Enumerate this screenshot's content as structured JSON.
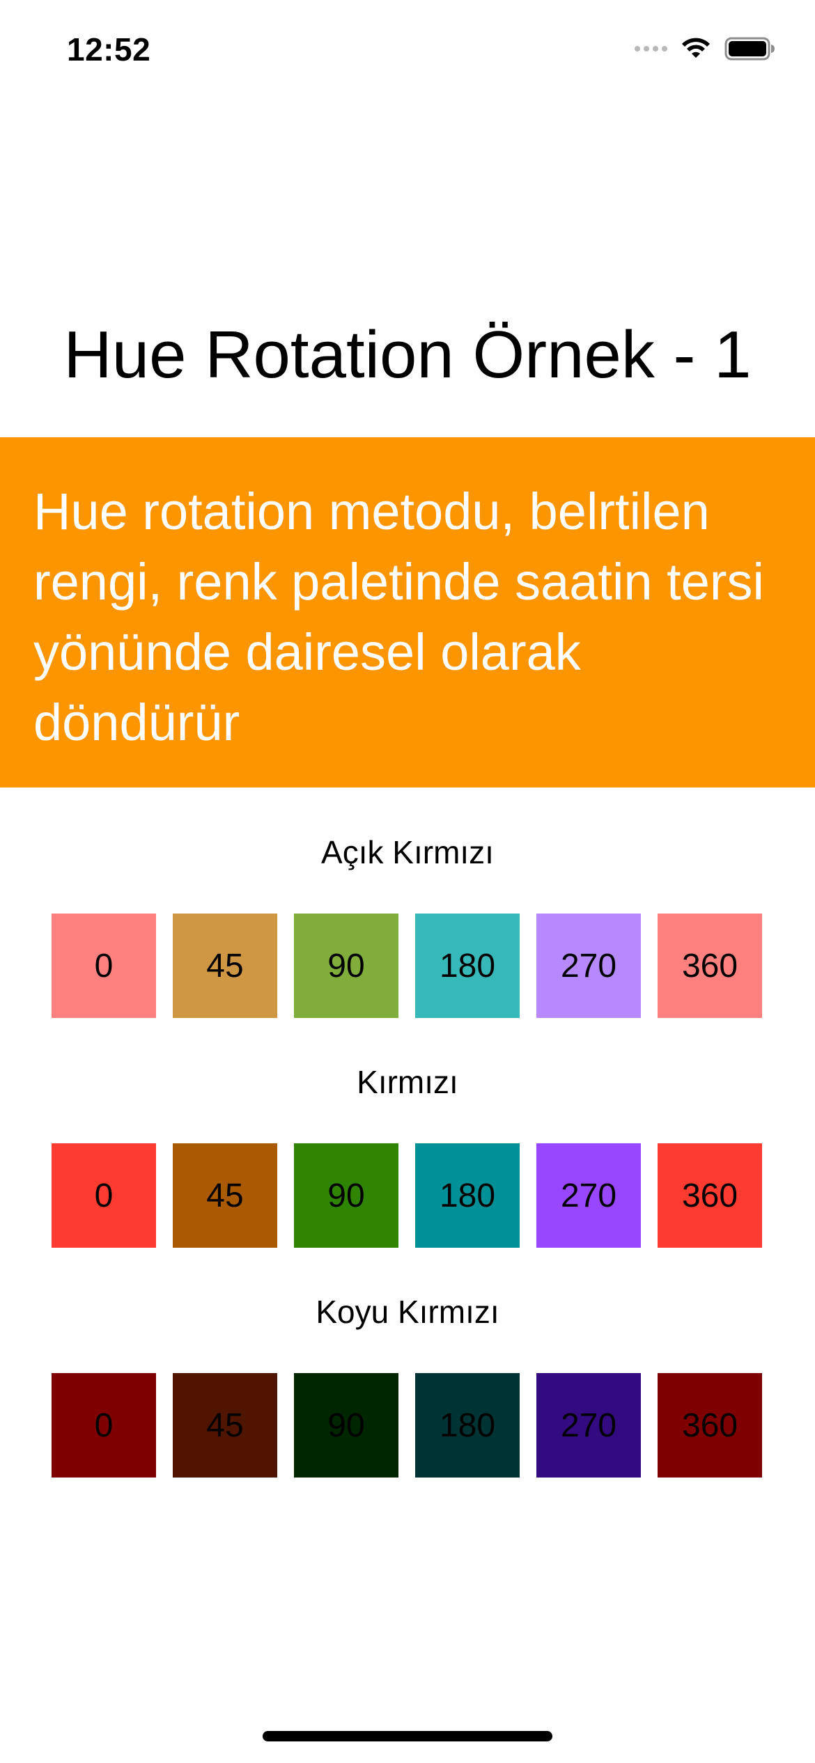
{
  "status_bar": {
    "time": "12:52",
    "icons": [
      "signal-dots-icon",
      "wifi-icon",
      "battery-icon"
    ]
  },
  "title": "Hue Rotation Örnek - 1",
  "banner": {
    "text": "Hue rotation metodu, belrtilen rengi, renk paletinde saatin tersi yönünde dairesel olarak döndürür",
    "background": "#fd9501"
  },
  "groups": [
    {
      "label": "Açık Kırmızı",
      "swatches": [
        {
          "label": "0",
          "color": "#fe8180"
        },
        {
          "label": "45",
          "color": "#cf9643"
        },
        {
          "label": "90",
          "color": "#80ad3b"
        },
        {
          "label": "180",
          "color": "#37b8b9"
        },
        {
          "label": "270",
          "color": "#b689fe"
        },
        {
          "label": "360",
          "color": "#fe8180"
        }
      ]
    },
    {
      "label": "Kırmızı",
      "swatches": [
        {
          "label": "0",
          "color": "#fe3b30"
        },
        {
          "label": "45",
          "color": "#aa5a00"
        },
        {
          "label": "90",
          "color": "#2f8501"
        },
        {
          "label": "180",
          "color": "#009097"
        },
        {
          "label": "270",
          "color": "#9947fe"
        },
        {
          "label": "360",
          "color": "#fe3b30"
        }
      ]
    },
    {
      "label": "Koyu Kırmızı",
      "swatches": [
        {
          "label": "0",
          "color": "#7f0000"
        },
        {
          "label": "45",
          "color": "#4f1500"
        },
        {
          "label": "90",
          "color": "#002600"
        },
        {
          "label": "180",
          "color": "#003334"
        },
        {
          "label": "270",
          "color": "#340a80"
        },
        {
          "label": "360",
          "color": "#7f0000"
        }
      ]
    }
  ]
}
